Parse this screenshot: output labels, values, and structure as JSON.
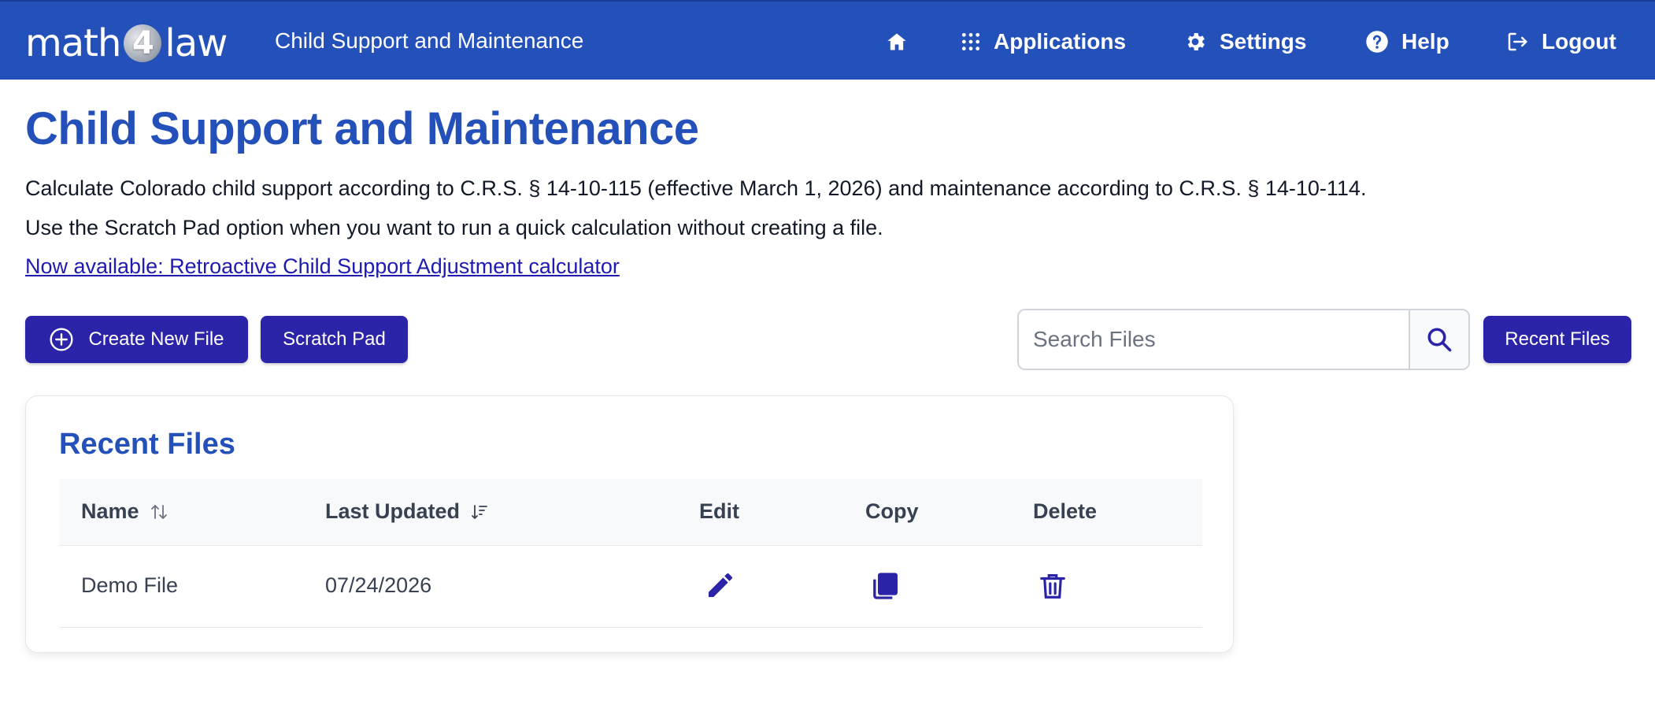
{
  "header": {
    "logo_left": "math",
    "logo_num": "4",
    "logo_right": "law",
    "app_name": "Child Support and Maintenance",
    "nav": {
      "applications": "Applications",
      "settings": "Settings",
      "help": "Help",
      "logout": "Logout"
    }
  },
  "intro": {
    "title": "Child Support and Maintenance",
    "line1": "Calculate Colorado child support according to C.R.S. § 14-10-115 (effective March 1, 2026) and maintenance according to C.R.S. § 14-10-114.",
    "line2": "Use the Scratch Pad option when you want to run a quick calculation without creating a file.",
    "link": "Now available: Retroactive Child Support Adjustment calculator"
  },
  "actions": {
    "create": "Create New File",
    "scratch": "Scratch Pad",
    "search_placeholder": "Search Files",
    "recent": "Recent Files"
  },
  "recent": {
    "title": "Recent Files",
    "columns": {
      "name": "Name",
      "updated": "Last Updated",
      "edit": "Edit",
      "copy": "Copy",
      "delete": "Delete"
    },
    "rows": [
      {
        "name": "Demo File",
        "updated": "07/24/2026"
      }
    ]
  },
  "colors": {
    "header_bg": "#2450b9",
    "button_bg": "#2b24a8",
    "title": "#2450b9",
    "link": "#1e1bb0"
  },
  "icons": [
    "home-icon",
    "grid-icon",
    "gear-icon",
    "help-icon",
    "logout-icon",
    "plus-circle-icon",
    "search-icon",
    "sort-icon",
    "sort-desc-icon",
    "pencil-icon",
    "copy-icon",
    "trash-icon"
  ]
}
